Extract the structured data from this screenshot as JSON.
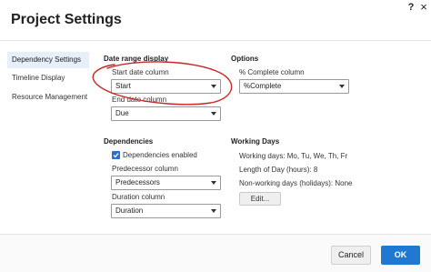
{
  "dialog": {
    "title": "Project Settings",
    "help": "?",
    "close": "×"
  },
  "sidebar": {
    "items": [
      {
        "label": "Dependency Settings",
        "active": true
      },
      {
        "label": "Timeline Display",
        "active": false
      },
      {
        "label": "Resource Management",
        "active": false
      }
    ]
  },
  "date_range": {
    "section_label": "Date range display",
    "start_label": "Start date column",
    "start_value": "Start",
    "end_label": "End date column",
    "end_value": "Due"
  },
  "options": {
    "section_label": "Options",
    "complete_label": "% Complete column",
    "complete_value": "%Complete"
  },
  "dependencies": {
    "section_label": "Dependencies",
    "enabled_label": "Dependencies enabled",
    "enabled_checked": true,
    "predecessor_label": "Predecessor column",
    "predecessor_value": "Predecessors",
    "duration_label": "Duration column",
    "duration_value": "Duration"
  },
  "working_days": {
    "section_label": "Working Days",
    "days_text": "Working days: Mo, Tu, We, Th, Fr",
    "length_text": "Length of Day (hours): 8",
    "nonworking_text": "Non-working days (holidays): None",
    "edit_label": "Edit..."
  },
  "footer": {
    "cancel_label": "Cancel",
    "ok_label": "OK"
  },
  "colors": {
    "accent": "#1f78d1",
    "checkbox": "#2a6fcc",
    "annotation": "#c62828",
    "sidebar_active": "#e6effa"
  }
}
